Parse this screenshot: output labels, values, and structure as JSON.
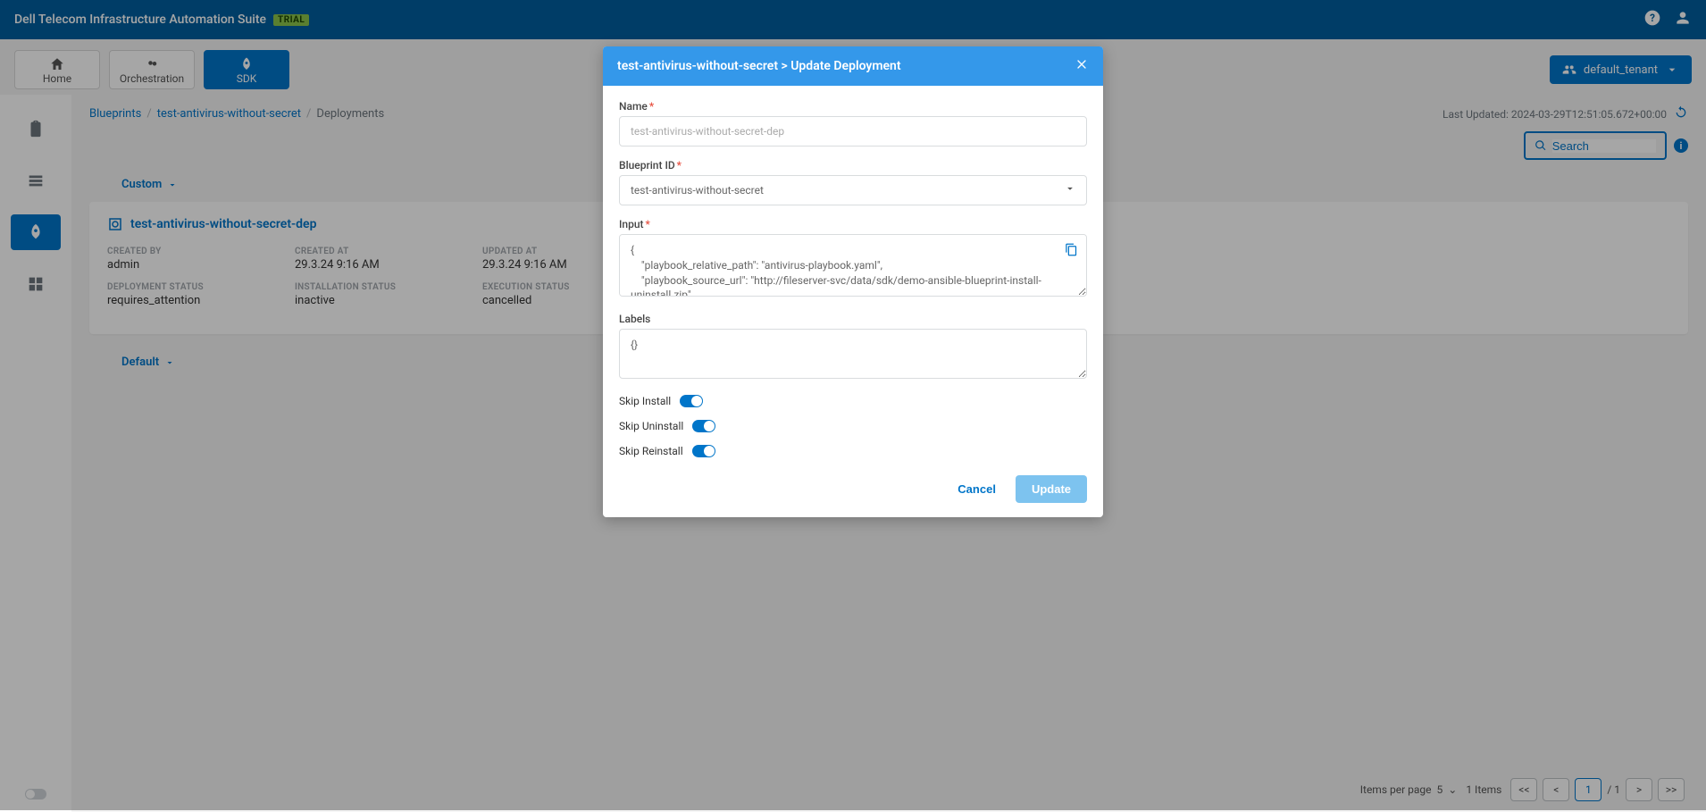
{
  "header": {
    "title": "Dell Telecom Infrastructure Automation Suite",
    "trial_badge": "TRIAL",
    "tenant_label": "default_tenant"
  },
  "tabs": {
    "home": "Home",
    "orchestration": "Orchestration",
    "sdk": "SDK"
  },
  "breadcrumb": {
    "b1": "Blueprints",
    "b2": "test-antivirus-without-secret",
    "b3": "Deployments"
  },
  "last_updated": "Last Updated: 2024-03-29T12:51:05.672+00:00",
  "search_placeholder": "Search",
  "sections": {
    "custom": "Custom",
    "default": "Default"
  },
  "card": {
    "title": "test-antivirus-without-secret-dep",
    "labels": {
      "created_by": "CREATED BY",
      "created_at": "CREATED AT",
      "updated_at": "UPDATED AT",
      "deployment_status": "DEPLOYMENT STATUS",
      "installation_status": "INSTALLATION STATUS",
      "execution_status": "EXECUTION STATUS"
    },
    "values": {
      "created_by": "admin",
      "created_at": "29.3.24 9:16 AM",
      "updated_at": "29.3.24 9:16 AM",
      "deployment_status": "requires_attention",
      "installation_status": "inactive",
      "execution_status": "cancelled"
    }
  },
  "pagination": {
    "items_per_page_label": "Items per page",
    "items_per_page_value": "5",
    "items_text": "1 Items",
    "first": "<<",
    "prev": "<",
    "page": "1",
    "total": "/ 1",
    "next": ">",
    "last": ">>"
  },
  "modal": {
    "title": "test-antivirus-without-secret > Update Deployment",
    "labels": {
      "name": "Name",
      "blueprint_id": "Blueprint ID",
      "input": "Input",
      "labels": "Labels",
      "skip_install": "Skip Install",
      "skip_uninstall": "Skip Uninstall",
      "skip_reinstall": "Skip Reinstall"
    },
    "values": {
      "name_placeholder": "test-antivirus-without-secret-dep",
      "blueprint_id": "test-antivirus-without-secret",
      "input_json": "{\n    \"playbook_relative_path\": \"antivirus-playbook.yaml\",\n    \"playbook_source_url\": \"http://fileserver-svc/data/sdk/demo-ansible-blueprint-install-uninstall.zip\",\n    \"ssh_private_key_secret\": \"-----BEGIN OPENSSH PRIVATE KEY-----",
      "labels_value": "{}"
    },
    "actions": {
      "cancel": "Cancel",
      "update": "Update"
    }
  }
}
